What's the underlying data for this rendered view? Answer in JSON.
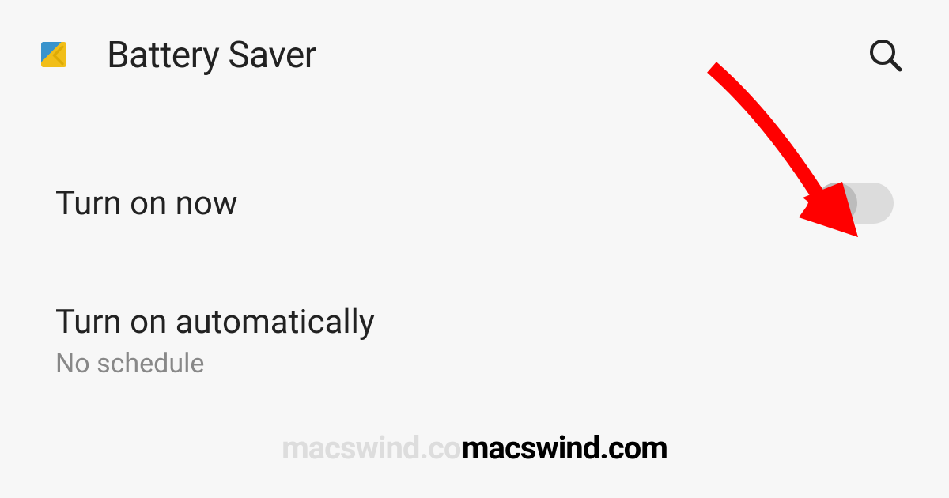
{
  "header": {
    "title": "Battery Saver"
  },
  "settings": {
    "turn_on_now": {
      "label": "Turn on now",
      "toggle_state": "off"
    },
    "turn_on_auto": {
      "label": "Turn on automatically",
      "sublabel": "No schedule"
    }
  },
  "watermark": {
    "faded": "macswind.con",
    "solid": "macswind.com"
  },
  "annotation": {
    "type": "red-arrow",
    "points_to": "turn-on-now-toggle"
  }
}
